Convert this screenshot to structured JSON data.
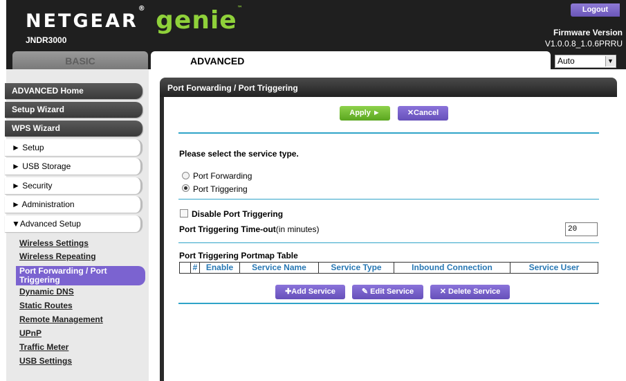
{
  "header": {
    "brand": "NETGEAR",
    "brand_reg": "®",
    "product": "genie",
    "product_tm": "™",
    "model": "JNDR3000",
    "logout_label": "Logout",
    "firmware_title": "Firmware Version",
    "firmware_version": "V1.0.0.8_1.0.6PRRU",
    "language_value": "Auto",
    "tabs": [
      {
        "label": "BASIC",
        "active": false
      },
      {
        "label": "ADVANCED",
        "active": true
      }
    ]
  },
  "sidebar": {
    "primary": [
      "ADVANCED Home",
      "Setup Wizard",
      "WPS Wizard"
    ],
    "sections": [
      {
        "label": "► Setup"
      },
      {
        "label": "► USB Storage"
      },
      {
        "label": "► Security"
      },
      {
        "label": "► Administration"
      },
      {
        "label": "▼Advanced Setup"
      }
    ],
    "sub_items": [
      "Wireless Settings",
      "Wireless Repeating",
      "Port Forwarding / Port Triggering",
      "Dynamic DNS",
      "Static Routes",
      "Remote Management",
      "UPnP",
      "Traffic Meter",
      "USB Settings"
    ],
    "active_sub_line1": "Port Forwarding / Port",
    "active_sub_line2": "Triggering"
  },
  "main": {
    "title": "Port Forwarding / Port Triggering",
    "apply_label": "Apply ►",
    "cancel_label": "✕Cancel",
    "service_type_prompt": "Please select the service type.",
    "service_types": [
      {
        "label": "Port Forwarding",
        "selected": false
      },
      {
        "label": "Port Triggering",
        "selected": true
      }
    ],
    "disable_label": "Disable Port Triggering",
    "disable_checked": false,
    "timeout_label": "Port Triggering Time-out",
    "timeout_unit": "(in minutes)",
    "timeout_value": "20",
    "table_title": "Port Triggering Portmap Table",
    "table_columns": [
      "#",
      "Enable",
      "Service Name",
      "Service Type",
      "Inbound Connection",
      "Service User"
    ],
    "add_label": "✚Add Service",
    "edit_label": "✎ Edit Service",
    "delete_label": "✕ Delete Service"
  },
  "colors": {
    "accent_purple": "#7b63d0",
    "apply_green": "#6ab82f",
    "rule_blue": "#2fa4c8",
    "table_header_blue": "#2878b4"
  }
}
